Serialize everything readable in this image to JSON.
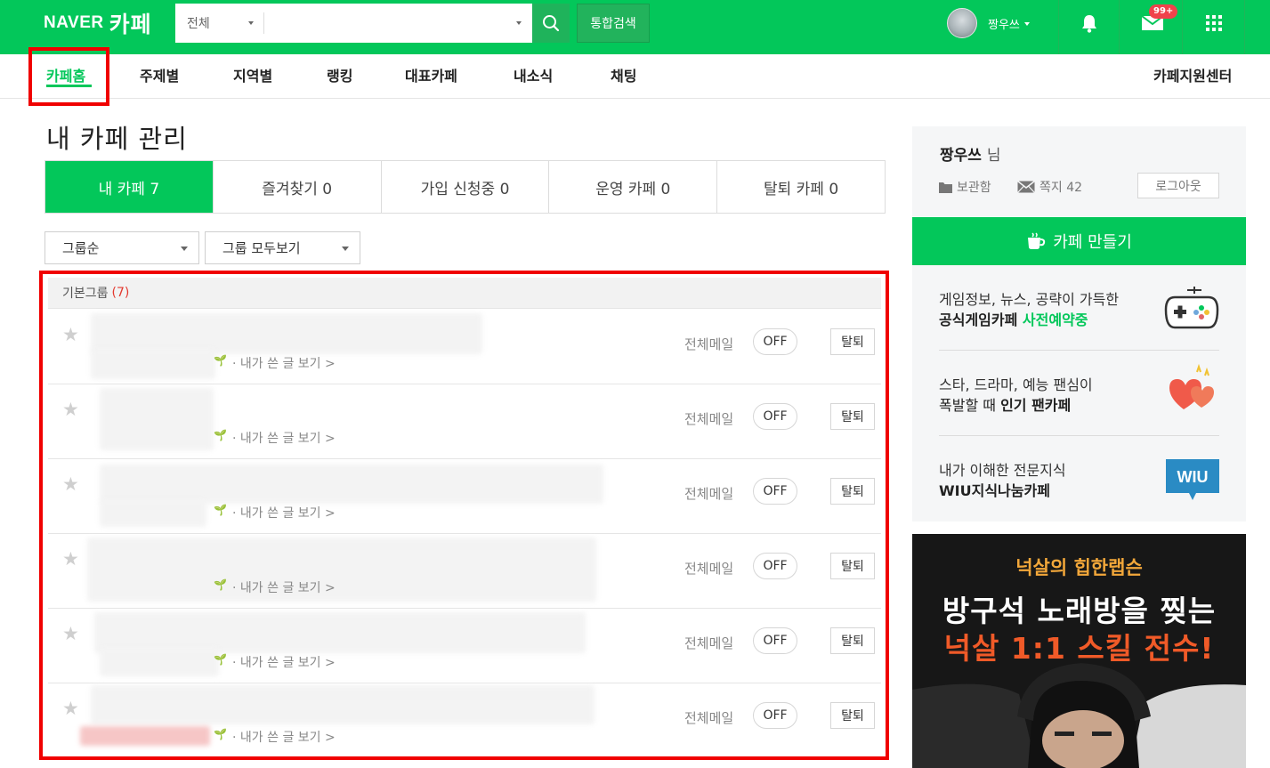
{
  "header": {
    "logo_naver": "NAVER",
    "logo_cafe": "카페",
    "search_scope": "전체",
    "search_value": "",
    "total_search_label": "통합검색",
    "user_name": "짱우쓰",
    "mail_badge": "99+"
  },
  "nav": {
    "items": [
      "카페홈",
      "주제별",
      "지역별",
      "랭킹",
      "대표카페",
      "내소식",
      "채팅"
    ],
    "active": "카페홈",
    "support_center": "카페지원센터"
  },
  "page": {
    "title": "내 카페 관리",
    "tabs": [
      "내 카페 7",
      "즐겨찾기 0",
      "가입 신청중 0",
      "운영 카페 0",
      "탈퇴 카페 0"
    ],
    "active_tab": "내 카페 7",
    "sort_dropdown": "그룹순",
    "group_dropdown": "그룹 모두보기"
  },
  "group": {
    "name": "기본그룹",
    "count": "(7)"
  },
  "cafes": [
    {
      "my_posts": "· 내가 쓴 글 보기 >",
      "mail_label": "전체메일",
      "mail_state": "OFF",
      "leave_label": "탈퇴"
    },
    {
      "my_posts": "· 내가 쓴 글 보기 >",
      "mail_label": "전체메일",
      "mail_state": "OFF",
      "leave_label": "탈퇴"
    },
    {
      "my_posts": "· 내가 쓴 글 보기 >",
      "mail_label": "전체메일",
      "mail_state": "OFF",
      "leave_label": "탈퇴"
    },
    {
      "my_posts": "· 내가 쓴 글 보기 >",
      "mail_label": "전체메일",
      "mail_state": "OFF",
      "leave_label": "탈퇴"
    },
    {
      "my_posts": "· 내가 쓴 글 보기 >",
      "mail_label": "전체메일",
      "mail_state": "OFF",
      "leave_label": "탈퇴"
    },
    {
      "my_posts": "· 내가 쓴 글 보기 >",
      "mail_label": "전체메일",
      "mail_state": "OFF",
      "leave_label": "탈퇴"
    }
  ],
  "profile": {
    "name": "짱우쓰",
    "suffix": "님",
    "saved_label": "보관함",
    "notes_label": "쪽지 42",
    "logout_label": "로그아웃"
  },
  "make_cafe_label": "카페 만들기",
  "promos": [
    {
      "line1": "게임정보, 뉴스, 공략이 가득한",
      "line2_a": "공식게임카페",
      "line2_b": "사전예약중",
      "icon": "gamepad-icon"
    },
    {
      "line1": "스타, 드라마, 예능 팬심이",
      "line2_a": "폭발할 때",
      "line2_b": "인기 팬카페",
      "icon": "hearts-icon"
    },
    {
      "line1": "내가 이해한 전문지식",
      "line2_a": "WIU지식나눔카페",
      "line2_b": "",
      "icon": "wiu-icon",
      "icon_text": "WIU"
    }
  ],
  "ad": {
    "line1": "넉살의 힙한랩슨",
    "line2": "방구석 노래방을 찢는",
    "line3": "넉살 1:1 스킬 전수!"
  },
  "colors": {
    "brand_green": "#03c75a",
    "highlight_red": "#f00000",
    "badge_red": "#f0424b"
  }
}
